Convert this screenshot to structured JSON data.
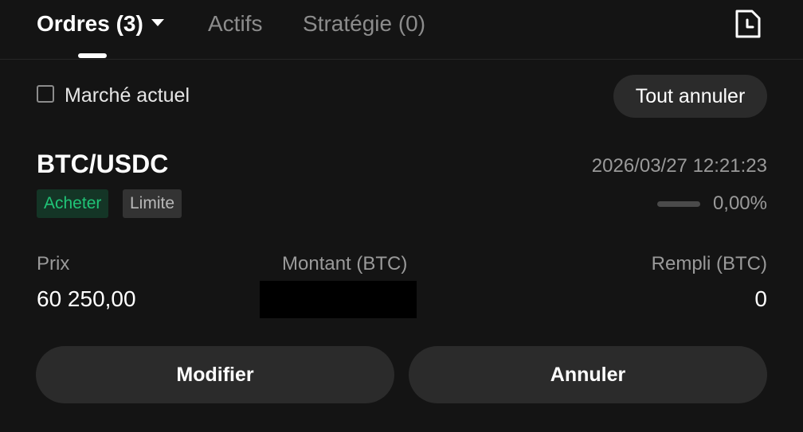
{
  "tabs": {
    "orders_label": "Ordres (3)",
    "assets_label": "Actifs",
    "strategy_label": "Stratégie (0)",
    "active": "orders"
  },
  "icons": {
    "dropdown": "caret-down-icon",
    "history": "history-icon"
  },
  "filter": {
    "current_market_label": "Marché actuel",
    "current_market_checked": false,
    "cancel_all_label": "Tout annuler"
  },
  "order": {
    "pair": "BTC/USDC",
    "timestamp": "2026/03/27 12:21:23",
    "side": "Acheter",
    "type": "Limite",
    "fill_percent_text": "0,00%",
    "fill_fraction": 0,
    "price_label": "Prix",
    "price_value": "60 250,00",
    "amount_label": "Montant (BTC)",
    "filled_label": "Rempli (BTC)",
    "filled_value": "0",
    "modify_label": "Modifier",
    "cancel_label": "Annuler"
  },
  "colors": {
    "background": "#141414",
    "buy_green": "#20c477",
    "buy_badge_bg": "#143526",
    "button_bg": "#2b2b2b",
    "muted_text": "#9a9a9a"
  }
}
